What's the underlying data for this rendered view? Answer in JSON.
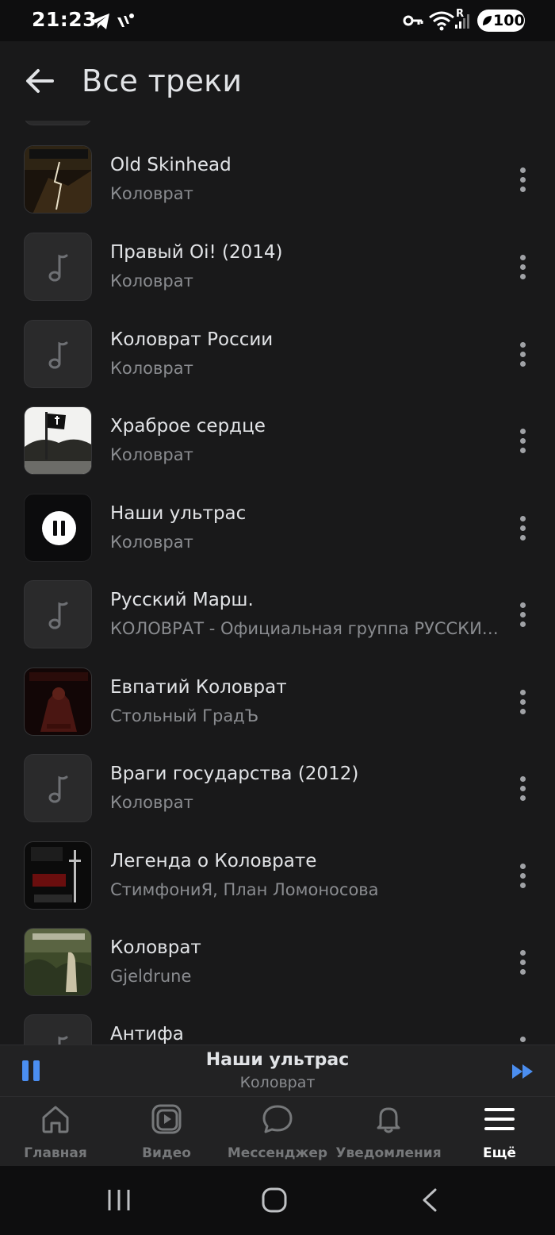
{
  "status_bar": {
    "time": "21:23",
    "battery": "100",
    "network_label": "R"
  },
  "header": {
    "title": "Все треки"
  },
  "tracks": [
    {
      "title": "Old Skinhead",
      "artist": "Коловрат",
      "cover": "art"
    },
    {
      "title": "Правый Oi! (2014)",
      "artist": "Коловрат",
      "cover": "placeholder"
    },
    {
      "title": "Коловрат России",
      "artist": "Коловрат",
      "cover": "placeholder"
    },
    {
      "title": "Храброе сердце",
      "artist": "Коловрат",
      "cover": "art"
    },
    {
      "title": "Наши ультрас",
      "artist": "Коловрат",
      "cover": "playing"
    },
    {
      "title": "Русский Марш.",
      "artist": "КОЛОВРАТ - Официальная группа РУССКИ…",
      "cover": "placeholder"
    },
    {
      "title": "Евпатий Коловрат",
      "artist": "Стольный ГрадЪ",
      "cover": "art"
    },
    {
      "title": "Враги государства (2012)",
      "artist": "Коловрат",
      "cover": "placeholder"
    },
    {
      "title": "Легенда о Коловрате",
      "artist": "СтимфониЯ, План Ломоносова",
      "cover": "art"
    },
    {
      "title": "Коловрат",
      "artist": "Gjeldrune",
      "cover": "art"
    },
    {
      "title": "Антифа",
      "artist": "",
      "cover": "placeholder"
    }
  ],
  "player": {
    "title": "Наши ультрас",
    "artist": "Коловрат",
    "state": "playing"
  },
  "tabs": [
    {
      "label": "Главная",
      "icon": "home-icon",
      "active": false
    },
    {
      "label": "Видео",
      "icon": "video-icon",
      "active": false
    },
    {
      "label": "Мессенджер",
      "icon": "chat-icon",
      "active": false
    },
    {
      "label": "Уведомления",
      "icon": "bell-icon",
      "active": false
    },
    {
      "label": "Ещё",
      "icon": "menu-icon",
      "active": true
    }
  ],
  "colors": {
    "background": "#19191a",
    "accent": "#4b8ef0",
    "secondary_text": "#8a8c90"
  }
}
